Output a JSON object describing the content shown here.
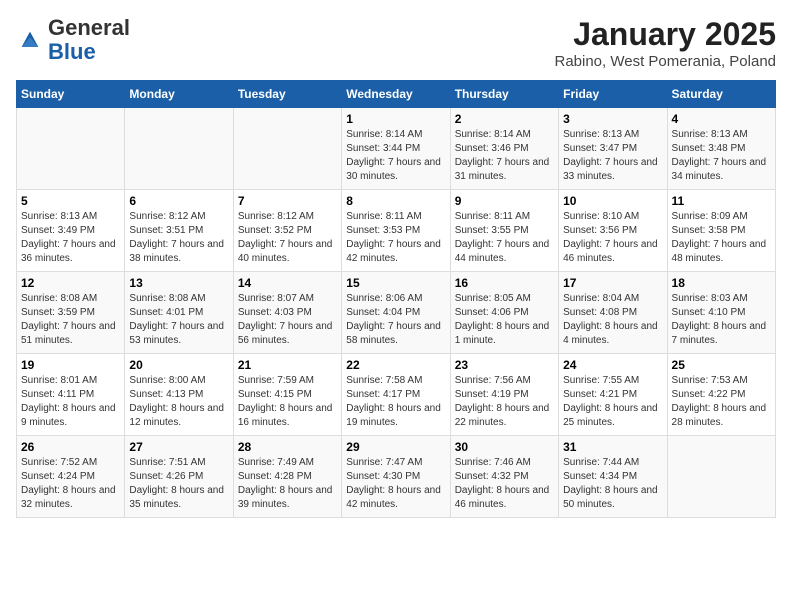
{
  "logo": {
    "general": "General",
    "blue": "Blue"
  },
  "title": "January 2025",
  "subtitle": "Rabino, West Pomerania, Poland",
  "weekdays": [
    "Sunday",
    "Monday",
    "Tuesday",
    "Wednesday",
    "Thursday",
    "Friday",
    "Saturday"
  ],
  "weeks": [
    [
      {
        "day": "",
        "info": ""
      },
      {
        "day": "",
        "info": ""
      },
      {
        "day": "",
        "info": ""
      },
      {
        "day": "1",
        "info": "Sunrise: 8:14 AM\nSunset: 3:44 PM\nDaylight: 7 hours\nand 30 minutes."
      },
      {
        "day": "2",
        "info": "Sunrise: 8:14 AM\nSunset: 3:46 PM\nDaylight: 7 hours\nand 31 minutes."
      },
      {
        "day": "3",
        "info": "Sunrise: 8:13 AM\nSunset: 3:47 PM\nDaylight: 7 hours\nand 33 minutes."
      },
      {
        "day": "4",
        "info": "Sunrise: 8:13 AM\nSunset: 3:48 PM\nDaylight: 7 hours\nand 34 minutes."
      }
    ],
    [
      {
        "day": "5",
        "info": "Sunrise: 8:13 AM\nSunset: 3:49 PM\nDaylight: 7 hours\nand 36 minutes."
      },
      {
        "day": "6",
        "info": "Sunrise: 8:12 AM\nSunset: 3:51 PM\nDaylight: 7 hours\nand 38 minutes."
      },
      {
        "day": "7",
        "info": "Sunrise: 8:12 AM\nSunset: 3:52 PM\nDaylight: 7 hours\nand 40 minutes."
      },
      {
        "day": "8",
        "info": "Sunrise: 8:11 AM\nSunset: 3:53 PM\nDaylight: 7 hours\nand 42 minutes."
      },
      {
        "day": "9",
        "info": "Sunrise: 8:11 AM\nSunset: 3:55 PM\nDaylight: 7 hours\nand 44 minutes."
      },
      {
        "day": "10",
        "info": "Sunrise: 8:10 AM\nSunset: 3:56 PM\nDaylight: 7 hours\nand 46 minutes."
      },
      {
        "day": "11",
        "info": "Sunrise: 8:09 AM\nSunset: 3:58 PM\nDaylight: 7 hours\nand 48 minutes."
      }
    ],
    [
      {
        "day": "12",
        "info": "Sunrise: 8:08 AM\nSunset: 3:59 PM\nDaylight: 7 hours\nand 51 minutes."
      },
      {
        "day": "13",
        "info": "Sunrise: 8:08 AM\nSunset: 4:01 PM\nDaylight: 7 hours\nand 53 minutes."
      },
      {
        "day": "14",
        "info": "Sunrise: 8:07 AM\nSunset: 4:03 PM\nDaylight: 7 hours\nand 56 minutes."
      },
      {
        "day": "15",
        "info": "Sunrise: 8:06 AM\nSunset: 4:04 PM\nDaylight: 7 hours\nand 58 minutes."
      },
      {
        "day": "16",
        "info": "Sunrise: 8:05 AM\nSunset: 4:06 PM\nDaylight: 8 hours\nand 1 minute."
      },
      {
        "day": "17",
        "info": "Sunrise: 8:04 AM\nSunset: 4:08 PM\nDaylight: 8 hours\nand 4 minutes."
      },
      {
        "day": "18",
        "info": "Sunrise: 8:03 AM\nSunset: 4:10 PM\nDaylight: 8 hours\nand 7 minutes."
      }
    ],
    [
      {
        "day": "19",
        "info": "Sunrise: 8:01 AM\nSunset: 4:11 PM\nDaylight: 8 hours\nand 9 minutes."
      },
      {
        "day": "20",
        "info": "Sunrise: 8:00 AM\nSunset: 4:13 PM\nDaylight: 8 hours\nand 12 minutes."
      },
      {
        "day": "21",
        "info": "Sunrise: 7:59 AM\nSunset: 4:15 PM\nDaylight: 8 hours\nand 16 minutes."
      },
      {
        "day": "22",
        "info": "Sunrise: 7:58 AM\nSunset: 4:17 PM\nDaylight: 8 hours\nand 19 minutes."
      },
      {
        "day": "23",
        "info": "Sunrise: 7:56 AM\nSunset: 4:19 PM\nDaylight: 8 hours\nand 22 minutes."
      },
      {
        "day": "24",
        "info": "Sunrise: 7:55 AM\nSunset: 4:21 PM\nDaylight: 8 hours\nand 25 minutes."
      },
      {
        "day": "25",
        "info": "Sunrise: 7:53 AM\nSunset: 4:22 PM\nDaylight: 8 hours\nand 28 minutes."
      }
    ],
    [
      {
        "day": "26",
        "info": "Sunrise: 7:52 AM\nSunset: 4:24 PM\nDaylight: 8 hours\nand 32 minutes."
      },
      {
        "day": "27",
        "info": "Sunrise: 7:51 AM\nSunset: 4:26 PM\nDaylight: 8 hours\nand 35 minutes."
      },
      {
        "day": "28",
        "info": "Sunrise: 7:49 AM\nSunset: 4:28 PM\nDaylight: 8 hours\nand 39 minutes."
      },
      {
        "day": "29",
        "info": "Sunrise: 7:47 AM\nSunset: 4:30 PM\nDaylight: 8 hours\nand 42 minutes."
      },
      {
        "day": "30",
        "info": "Sunrise: 7:46 AM\nSunset: 4:32 PM\nDaylight: 8 hours\nand 46 minutes."
      },
      {
        "day": "31",
        "info": "Sunrise: 7:44 AM\nSunset: 4:34 PM\nDaylight: 8 hours\nand 50 minutes."
      },
      {
        "day": "",
        "info": ""
      }
    ]
  ]
}
